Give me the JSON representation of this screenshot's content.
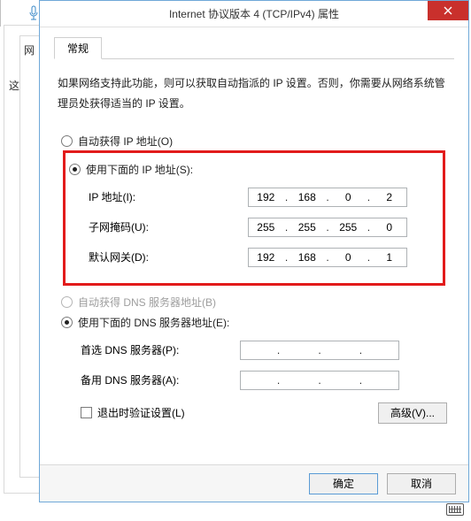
{
  "background": {
    "char1": "这",
    "char2": "网"
  },
  "titlebar": {
    "title": "Internet 协议版本 4 (TCP/IPv4) 属性"
  },
  "tab": {
    "general": "常规"
  },
  "description": "如果网络支持此功能，则可以获取自动指派的 IP 设置。否则，你需要从网络系统管理员处获得适当的 IP 设置。",
  "ip_section": {
    "auto_label": "自动获得 IP 地址(O)",
    "manual_label": "使用下面的 IP 地址(S):",
    "fields": {
      "ip": {
        "label": "IP 地址(I):",
        "value": [
          "192",
          "168",
          "0",
          "2"
        ]
      },
      "mask": {
        "label": "子网掩码(U):",
        "value": [
          "255",
          "255",
          "255",
          "0"
        ]
      },
      "gateway": {
        "label": "默认网关(D):",
        "value": [
          "192",
          "168",
          "0",
          "1"
        ]
      }
    }
  },
  "dns_section": {
    "auto_label": "自动获得 DNS 服务器地址(B)",
    "manual_label": "使用下面的 DNS 服务器地址(E):",
    "fields": {
      "preferred": {
        "label": "首选 DNS 服务器(P):",
        "value": [
          "",
          "",
          "",
          ""
        ]
      },
      "alternate": {
        "label": "备用 DNS 服务器(A):",
        "value": [
          "",
          "",
          "",
          ""
        ]
      }
    }
  },
  "validate_label": "退出时验证设置(L)",
  "buttons": {
    "advanced": "高级(V)...",
    "ok": "确定",
    "cancel": "取消"
  }
}
